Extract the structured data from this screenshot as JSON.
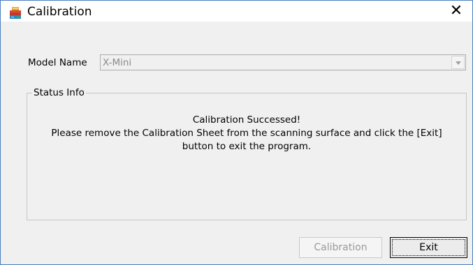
{
  "window": {
    "title": "Calibration",
    "close_glyph": "✕",
    "icon": "scanner-app-icon"
  },
  "model": {
    "label": "Model Name",
    "value": "X-Mini",
    "dropdown_icon": "chevron-down-icon"
  },
  "status": {
    "group_title": "Status Info",
    "lines": [
      "Calibration Successed!",
      "Please remove the Calibration Sheet from the scanning surface and click the [Exit]",
      "button to exit the program."
    ]
  },
  "buttons": {
    "calibration_label": "Calibration",
    "calibration_enabled": false,
    "exit_label": "Exit"
  },
  "colors": {
    "window_border": "#4a7fc1",
    "dialog_bg": "#f0f0f0",
    "disabled_text": "#9a9a9a"
  }
}
